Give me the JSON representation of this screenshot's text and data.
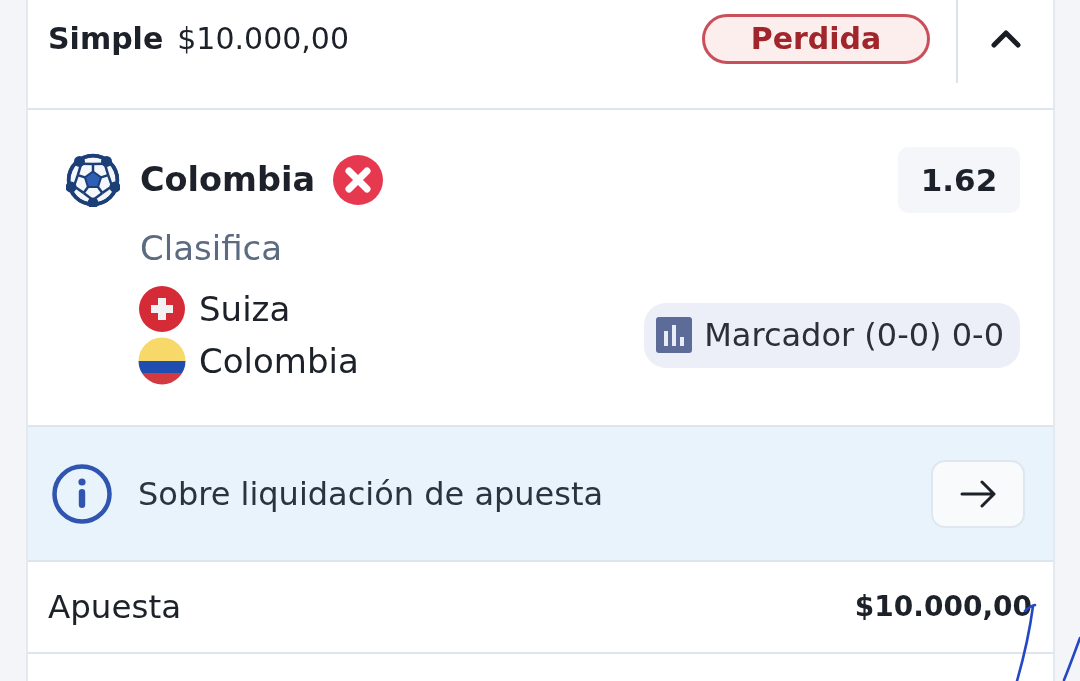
{
  "bet": {
    "type": "Simple",
    "stake": "$10.000,00",
    "status": {
      "label": "Perdida",
      "kind": "lost"
    },
    "expanded": true
  },
  "selection": {
    "team": "Colombia",
    "lost": true,
    "odds": "1.62",
    "market": "Clasifica",
    "participants": [
      {
        "name": "Suiza",
        "kind": "switzerland"
      },
      {
        "name": "Colombia",
        "kind": "colombia"
      }
    ],
    "score": "Marcador (0-0) 0-0"
  },
  "settlement_info": {
    "text": "Sobre liquidación de apuesta"
  },
  "summary": [
    {
      "label": "Apuesta",
      "value": "$10.000,00"
    }
  ]
}
